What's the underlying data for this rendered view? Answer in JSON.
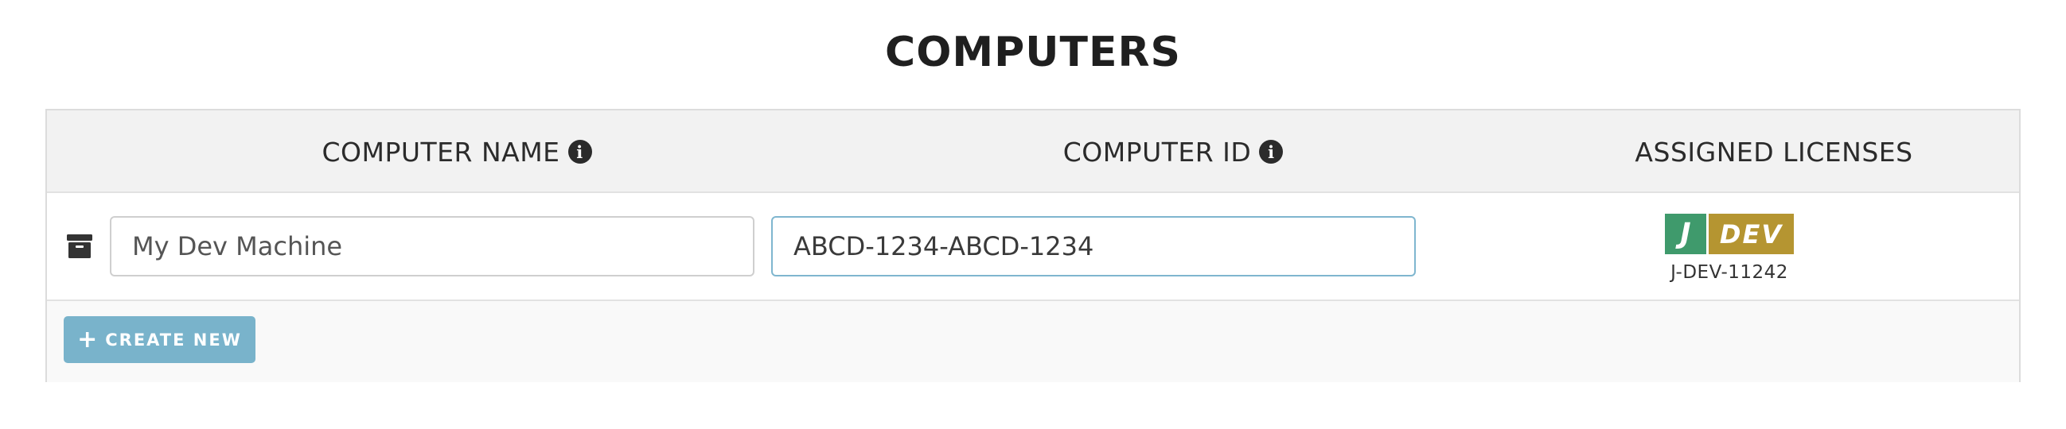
{
  "page": {
    "title": "COMPUTERS"
  },
  "table": {
    "headers": {
      "name": "COMPUTER NAME",
      "id": "COMPUTER ID",
      "licenses": "ASSIGNED LICENSES"
    },
    "rows": [
      {
        "computer_name": "My Dev Machine",
        "computer_id": "ABCD-1234-ABCD-1234",
        "license": {
          "badge_left": "J",
          "badge_right": "DEV",
          "code": "J-DEV-11242"
        }
      }
    ]
  },
  "actions": {
    "create_label": "CREATE NEW",
    "create_icon": "plus-icon"
  },
  "icons": {
    "info": "info-icon",
    "archive": "archive-icon"
  },
  "colors": {
    "primary_button": "#79b3cb",
    "badge_green": "#3f9a6c",
    "badge_gold": "#b59531",
    "header_bg": "#f2f2f2"
  }
}
